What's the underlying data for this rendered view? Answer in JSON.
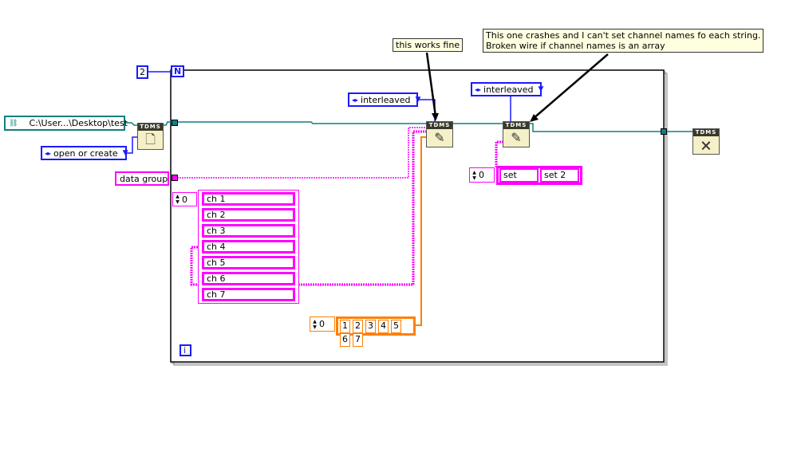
{
  "loop": {
    "count": "2",
    "n_label": "N",
    "i_label": "i"
  },
  "path_constant": {
    "value": "C:\\User...\\Desktop\\test"
  },
  "open_operation": {
    "value": "open or create"
  },
  "group_name": {
    "value": "data group"
  },
  "channel_names": {
    "index": "0",
    "items": [
      "ch 1",
      "ch 2",
      "ch 3",
      "ch 4",
      "ch 5",
      "ch 6",
      "ch 7"
    ]
  },
  "data_array": {
    "index": "0",
    "items": [
      "1",
      "2",
      "3",
      "4",
      "5",
      "6",
      "7"
    ]
  },
  "write1": {
    "layout": "interleaved",
    "comment": "this works fine"
  },
  "write2": {
    "layout": "interleaved",
    "comment_line1": "This one crashes and I can't set channel names fo each string.",
    "comment_line2": "Broken wire if channel names is an array",
    "index": "0",
    "items": [
      "set",
      "set 2"
    ]
  },
  "tdms_label": "TDMS",
  "colors": {
    "refnum": "#117f7f",
    "string": "#ff00ff",
    "numeric": "#ff7f00",
    "enum": "#1a1aff"
  }
}
